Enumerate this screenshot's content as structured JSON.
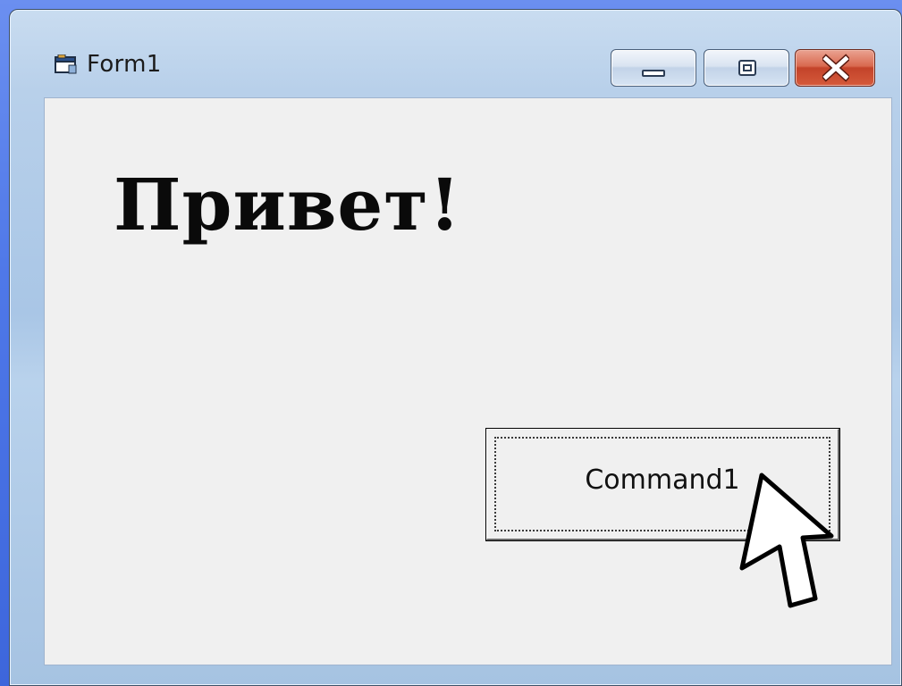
{
  "window": {
    "title": "Form1",
    "icon": "form-window-icon",
    "controls": {
      "minimize_icon": "minimize-icon",
      "maximize_icon": "maximize-icon",
      "close_icon": "close-icon"
    }
  },
  "form": {
    "label_text": "Привет!",
    "command_button_label": "Command1"
  },
  "pointer": {
    "icon": "mouse-pointer-icon"
  },
  "colors": {
    "desktop": "#4f78e8",
    "client_area": "#f0f0f0",
    "close_button": "#c3432a",
    "titlebar": "#b8d0ea"
  }
}
